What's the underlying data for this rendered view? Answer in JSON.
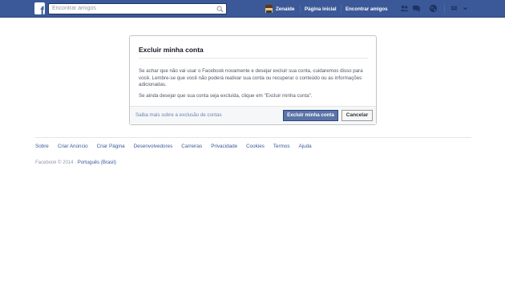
{
  "header": {
    "search_placeholder": "Encontrar amigos",
    "user_name": "Zenaide",
    "nav_home": "Página inicial",
    "nav_find_friends": "Encontrar amigos"
  },
  "dialog": {
    "title": "Excluir minha conta",
    "paragraph1": "Se achar que não vai usar o Facebook novamente e desejar excluir sua conta, cuidaremos disso para você. Lembre-se que você não poderá reativar sua conta ou recuperar o conteúdo ou as informações adicionadas.",
    "paragraph2": "Se ainda desejar que sua conta seja excluída, clique em \"Excluir minha conta\".",
    "learn_more": "Saiba mais sobre a exclusão de contas",
    "confirm_label": "Excluir minha conta",
    "cancel_label": "Cancelar"
  },
  "footer": {
    "links": [
      "Sobre",
      "Criar Anúncio",
      "Criar Página",
      "Desenvolvedores",
      "Carreiras",
      "Privacidade",
      "Cookies",
      "Termos",
      "Ajuda"
    ],
    "copyright": "Facebook © 2014 ·",
    "language": "Português (Brasil)"
  },
  "colors": {
    "brand_blue": "#3b5998",
    "primary_button": "#5b74a8"
  }
}
